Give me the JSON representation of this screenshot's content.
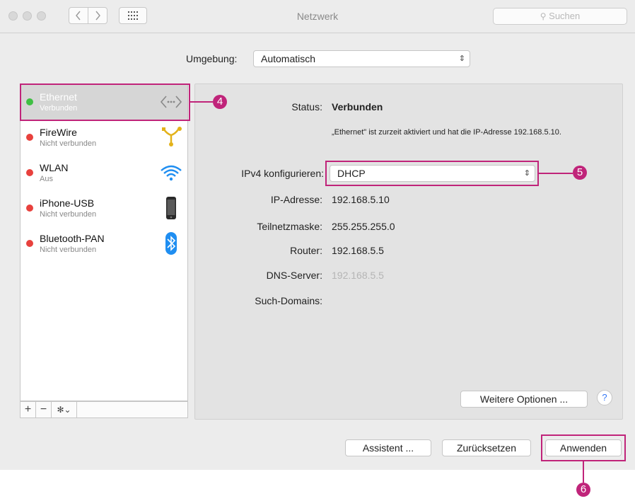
{
  "window": {
    "title": "Netzwerk",
    "search_placeholder": "Suchen"
  },
  "environment": {
    "label": "Umgebung:",
    "value": "Automatisch"
  },
  "services": [
    {
      "name": "Ethernet",
      "status": "Verbunden",
      "dot_color": "#3fbf43",
      "icon": "ethernet-icon",
      "selected": true
    },
    {
      "name": "FireWire",
      "status": "Nicht verbunden",
      "dot_color": "#e8413d",
      "icon": "firewire-icon"
    },
    {
      "name": "WLAN",
      "status": "Aus",
      "dot_color": "#e8413d",
      "icon": "wifi-icon"
    },
    {
      "name": "iPhone-USB",
      "status": "Nicht verbunden",
      "dot_color": "#e8413d",
      "icon": "iphone-icon"
    },
    {
      "name": "Bluetooth-PAN",
      "status": "Nicht verbunden",
      "dot_color": "#e8413d",
      "icon": "bluetooth-icon"
    }
  ],
  "toolbar": {
    "add": "+",
    "remove": "−",
    "gear": "✻⌄"
  },
  "detail": {
    "status_label": "Status:",
    "status_value": "Verbunden",
    "status_description": "„Ethernet\" ist zurzeit aktiviert und hat die IP-Adresse 192.168.5.10.",
    "ipv4_label": "IPv4 konfigurieren:",
    "ipv4_value": "DHCP",
    "ip_label": "IP-Adresse:",
    "ip_value": "192.168.5.10",
    "subnet_label": "Teilnetzmaske:",
    "subnet_value": "255.255.255.0",
    "router_label": "Router:",
    "router_value": "192.168.5.5",
    "dns_label": "DNS-Server:",
    "dns_value": "192.168.5.5",
    "search_domains_label": "Such-Domains:",
    "more_options": "Weitere Optionen ...",
    "help": "?"
  },
  "footer": {
    "assistant": "Assistent ...",
    "reset": "Zurücksetzen",
    "apply": "Anwenden"
  },
  "annotations": {
    "marker_4": "4",
    "marker_5": "5",
    "marker_6": "6"
  },
  "colors": {
    "highlight": "#c0247a",
    "selected_row": "#d6d6d6"
  }
}
